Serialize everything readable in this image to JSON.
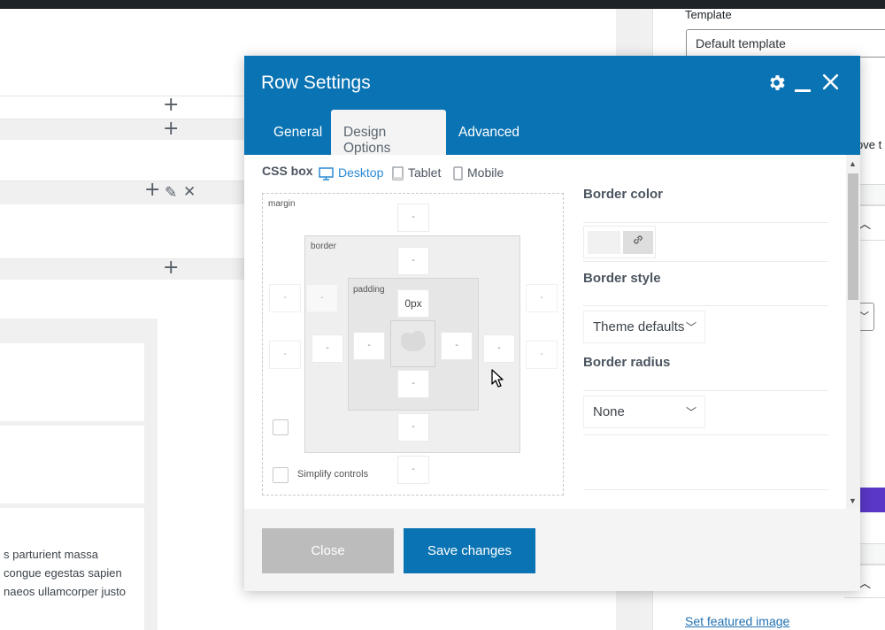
{
  "editor": {
    "row_controls": [
      "+",
      "+",
      "+",
      "✎",
      "✕",
      "+"
    ],
    "body_text": [
      "s parturient massa",
      "congue egestas sapien",
      "naeos ullamcorper justo"
    ]
  },
  "sidebar": {
    "template_label": "Template",
    "template_value": "Default template",
    "fragment_text": "ove t",
    "featured_image_link": "Set featured image"
  },
  "modal": {
    "title": "Row Settings",
    "tabs": [
      "General",
      "Design Options",
      "Advanced"
    ],
    "active_tab": "Design Options",
    "css_box_label": "CSS box",
    "devices": [
      "Desktop",
      "Tablet",
      "Mobile"
    ],
    "active_device": "Desktop",
    "box_labels": {
      "margin": "margin",
      "border": "border",
      "padding": "padding"
    },
    "padding_top_value": "0px",
    "placeholder": "-",
    "simplify_controls": "Simplify controls",
    "border_color_label": "Border color",
    "border_style_label": "Border style",
    "border_style_value": "Theme defaults",
    "border_radius_label": "Border radius",
    "border_radius_value": "None",
    "close_button": "Close",
    "save_button": "Save changes"
  },
  "icons": {
    "gear": "gear-icon",
    "minimize": "minimize-icon",
    "close": "close-icon",
    "desktop": "desktop-icon",
    "tablet": "tablet-icon",
    "mobile": "mobile-icon",
    "link": "link-icon",
    "chevron": "chevron-down-icon"
  },
  "colors": {
    "accent": "#0a73b3",
    "active_device": "#2a8ad4",
    "close_disabled": "#bcbcbc"
  }
}
